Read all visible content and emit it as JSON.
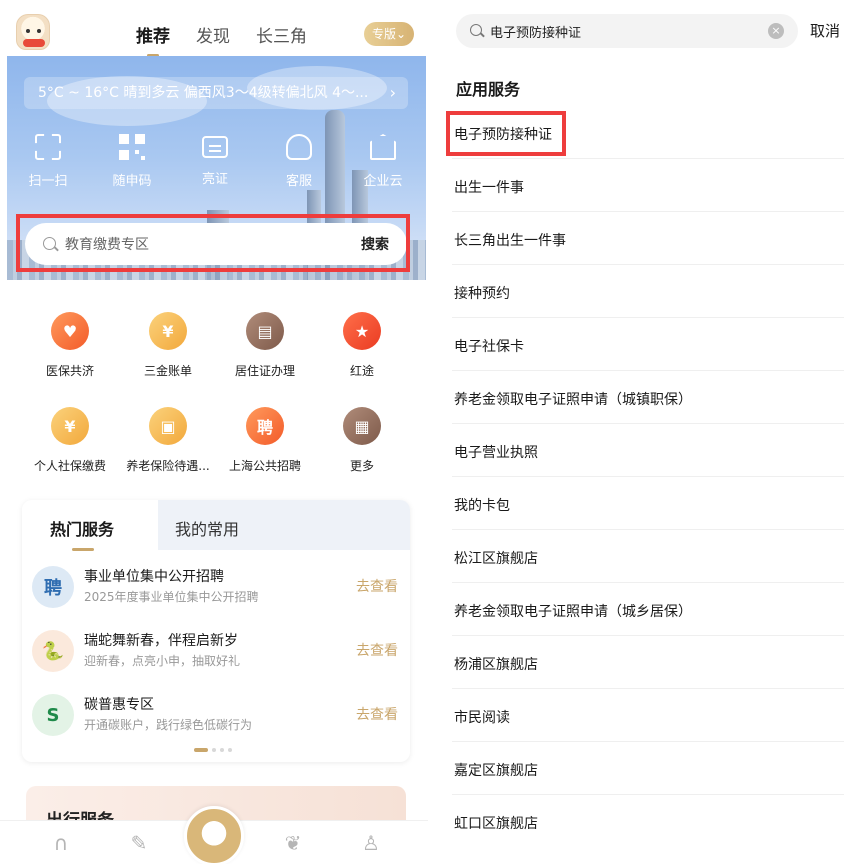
{
  "left": {
    "top_tabs": [
      "推荐",
      "发现",
      "长三角"
    ],
    "edition_label": "专版",
    "weather": "5°C ~ 16°C  晴到多云  偏西风3～4级转偏北风  4～...",
    "quick_actions": [
      {
        "label": "扫一扫",
        "icon": "scan-icon"
      },
      {
        "label": "随申码",
        "icon": "qrcode-icon"
      },
      {
        "label": "亮证",
        "icon": "id-card-icon"
      },
      {
        "label": "客服",
        "icon": "customer-service-icon"
      },
      {
        "label": "企业云",
        "icon": "enterprise-cloud-icon"
      }
    ],
    "search": {
      "placeholder": "教育缴费专区",
      "button": "搜索"
    },
    "services_row1": [
      {
        "label": "医保共济",
        "icon": "medical-insurance-icon",
        "glyph": "♥"
      },
      {
        "label": "三金账单",
        "icon": "bill-icon",
        "glyph": "¥"
      },
      {
        "label": "居住证办理",
        "icon": "residence-permit-icon",
        "glyph": "▤"
      },
      {
        "label": "红途",
        "icon": "star-icon",
        "glyph": "★"
      }
    ],
    "services_row2": [
      {
        "label": "个人社保缴费",
        "icon": "social-security-pay-icon",
        "glyph": "¥"
      },
      {
        "label": "养老保险待遇...",
        "icon": "pension-icon",
        "glyph": "▣"
      },
      {
        "label": "上海公共招聘",
        "icon": "recruitment-icon",
        "glyph": "聘"
      },
      {
        "label": "更多",
        "icon": "more-grid-icon",
        "glyph": "▦"
      }
    ],
    "hot": {
      "tabs": [
        "热门服务",
        "我的常用"
      ],
      "items": [
        {
          "title": "事业单位集中公开招聘",
          "sub": "2025年度事业单位集中公开招聘",
          "action": "去查看",
          "icon_glyph": "聘"
        },
        {
          "title": "瑞蛇舞新春，伴程启新岁",
          "sub": "迎新春，点亮小申，抽取好礼",
          "action": "去查看",
          "icon_glyph": "🐍"
        },
        {
          "title": "碳普惠专区",
          "sub": "开通碳账户，践行绿色低碳行为",
          "action": "去查看",
          "icon_glyph": "S"
        }
      ]
    },
    "travel_title": "出行服务"
  },
  "right": {
    "search_value": "电子预防接种证",
    "clear_glyph": "×",
    "cancel": "取消",
    "section_title": "应用服务",
    "results": [
      "电子预防接种证",
      "出生一件事",
      "长三角出生一件事",
      "接种预约",
      "电子社保卡",
      "养老金领取电子证照申请（城镇职保）",
      "电子营业执照",
      "我的卡包",
      "松江区旗舰店",
      "养老金领取电子证照申请（城乡居保）",
      "杨浦区旗舰店",
      "市民阅读",
      "嘉定区旗舰店",
      "虹口区旗舰店"
    ]
  }
}
